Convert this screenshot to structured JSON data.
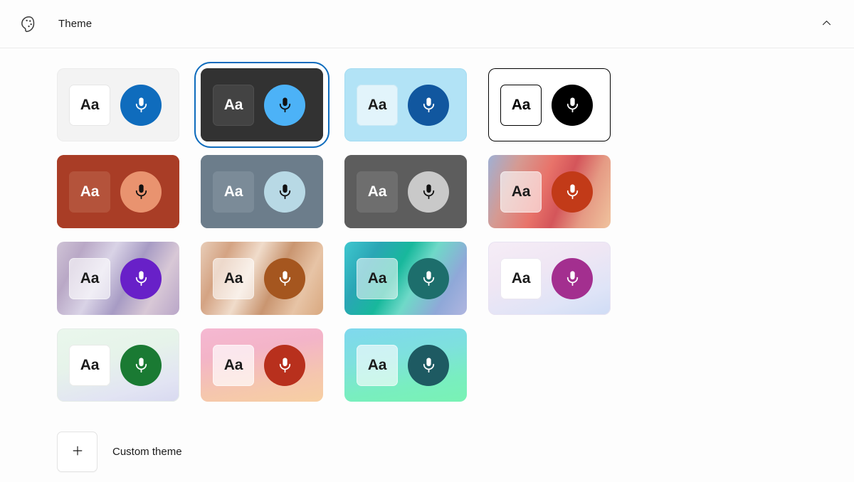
{
  "header": {
    "icon": "palette-icon",
    "title": "Theme",
    "collapse_icon": "chevron-up-icon"
  },
  "themes": {
    "aa_label": "Aa",
    "mic_icon": "microphone-icon",
    "selected_index": 1,
    "items": [
      {
        "name": "light",
        "card_bg": "#f3f3f3",
        "card_border": "#ececec",
        "tile_bg": "#ffffff",
        "tile_border": "#e6e6e6",
        "tile_text": "#1b1b1b",
        "mic_bg": "#0f6cbd",
        "mic_fg": "#ffffff"
      },
      {
        "name": "dark",
        "card_bg": "#323232",
        "card_border": "#323232",
        "tile_bg": "#434343",
        "tile_border": "#4f4f4f",
        "tile_text": "#ffffff",
        "mic_bg": "#4cb2f7",
        "mic_fg": "#111111"
      },
      {
        "name": "light-blue",
        "card_bg": "#b2e3f6",
        "card_border": "#a5dcf2",
        "tile_bg": "#e2f4fb",
        "tile_border": "#c9e9f5",
        "tile_text": "#1b1b1b",
        "mic_bg": "#11579f",
        "mic_fg": "#ffffff"
      },
      {
        "name": "high-contrast",
        "card_bg": "#ffffff",
        "card_border": "#000000",
        "tile_bg": "#ffffff",
        "tile_border": "#000000",
        "tile_text": "#000000",
        "mic_bg": "#000000",
        "mic_fg": "#ffffff"
      },
      {
        "name": "brick",
        "card_bg": "#a93d26",
        "card_border": "#a93d26",
        "tile_bg": "#b4533b",
        "tile_border": "#b4533b",
        "tile_text": "#ffffff",
        "mic_bg": "#e9936f",
        "mic_fg": "#111111"
      },
      {
        "name": "slate",
        "card_bg": "#6c7d8b",
        "card_border": "#6c7d8b",
        "tile_bg": "#7b8b98",
        "tile_border": "#7b8b98",
        "tile_text": "#ffffff",
        "mic_bg": "#b8d9e5",
        "mic_fg": "#111111"
      },
      {
        "name": "gray",
        "card_bg": "#5d5d5d",
        "card_border": "#5d5d5d",
        "tile_bg": "#6e6e6e",
        "tile_border": "#6e6e6e",
        "tile_text": "#ffffff",
        "mic_bg": "#c9c9c9",
        "mic_fg": "#111111"
      },
      {
        "name": "coral-wave",
        "card_bg": "linear-gradient(112deg,#9fb0d4 0%,#d59a92 22%,#e8736a 44%,#d4555a 60%,#e59a84 78%,#f0c39e 100%)",
        "card_border": "transparent",
        "tile_bg": "rgba(255,255,255,0.60)",
        "tile_border": "rgba(255,255,255,0.45)",
        "tile_text": "#1b1b1b",
        "mic_bg": "#c23a18",
        "mic_fg": "#ffffff"
      },
      {
        "name": "lavender-wave",
        "card_bg": "linear-gradient(118deg,#cfc3d6 0%,#b9a8c6 18%,#d9d3e6 38%,#a79bc4 58%,#d8c8d6 78%,#b9a6c8 100%)",
        "card_border": "transparent",
        "tile_bg": "rgba(255,255,255,0.62)",
        "tile_border": "rgba(255,255,255,0.48)",
        "tile_text": "#1b1b1b",
        "mic_bg": "#6820c8",
        "mic_fg": "#ffffff"
      },
      {
        "name": "sand-wave",
        "card_bg": "linear-gradient(115deg,#e8cdb8 0%,#d4a383 20%,#f0dccb 40%,#c99570 60%,#e7c4a6 80%,#d9a87f 100%)",
        "card_border": "transparent",
        "tile_bg": "rgba(255,255,255,0.58)",
        "tile_border": "rgba(255,255,255,0.45)",
        "tile_text": "#1b1b1b",
        "mic_bg": "#a5561f",
        "mic_fg": "#ffffff"
      },
      {
        "name": "teal-aurora",
        "card_bg": "linear-gradient(120deg,#3fc7cf 0%,#2aa6b5 22%,#18b89c 42%,#6fd9c8 58%,#8fa8d8 80%,#b0b6e0 100%)",
        "card_border": "transparent",
        "tile_bg": "rgba(255,255,255,0.55)",
        "tile_border": "rgba(255,255,255,0.42)",
        "tile_text": "#1b1b1b",
        "mic_bg": "#1d6e6c",
        "mic_fg": "#ffffff"
      },
      {
        "name": "pale-lilac",
        "card_bg": "linear-gradient(160deg,#f6edf6 0%,#efe6f4 40%,#dfe4f7 75%,#cfdcf5 100%)",
        "card_border": "#e8e3f2",
        "tile_bg": "#ffffff",
        "tile_border": "#eae6f0",
        "tile_text": "#1b1b1b",
        "mic_bg": "#a32f8f",
        "mic_fg": "#ffffff"
      },
      {
        "name": "mint-lilac",
        "card_bg": "linear-gradient(165deg,#eaf7ec 0%,#e6f3ea 40%,#e2e4f3 78%,#d8d9f0 100%)",
        "card_border": "#e5ece8",
        "tile_bg": "#ffffff",
        "tile_border": "#e8eae8",
        "tile_text": "#1b1b1b",
        "mic_bg": "#1a7a33",
        "mic_fg": "#ffffff"
      },
      {
        "name": "pink-peach",
        "card_bg": "linear-gradient(170deg,#f5b8d2 0%,#f3b4c8 32%,#f5c6ae 70%,#f7cfa2 100%)",
        "card_border": "transparent",
        "tile_bg": "rgba(255,255,255,0.68)",
        "tile_border": "rgba(255,255,255,0.55)",
        "tile_text": "#1b1b1b",
        "mic_bg": "#b8301d",
        "mic_fg": "#ffffff"
      },
      {
        "name": "cyan-mint",
        "card_bg": "linear-gradient(170deg,#7fd8ee 0%,#7ee0de 38%,#79eec0 72%,#79f2b4 100%)",
        "card_border": "transparent",
        "tile_bg": "rgba(255,255,255,0.62)",
        "tile_border": "rgba(255,255,255,0.5)",
        "tile_text": "#1b1b1b",
        "mic_bg": "#1e5a62",
        "mic_fg": "#ffffff"
      }
    ]
  },
  "custom": {
    "icon": "plus-icon",
    "label": "Custom theme"
  }
}
